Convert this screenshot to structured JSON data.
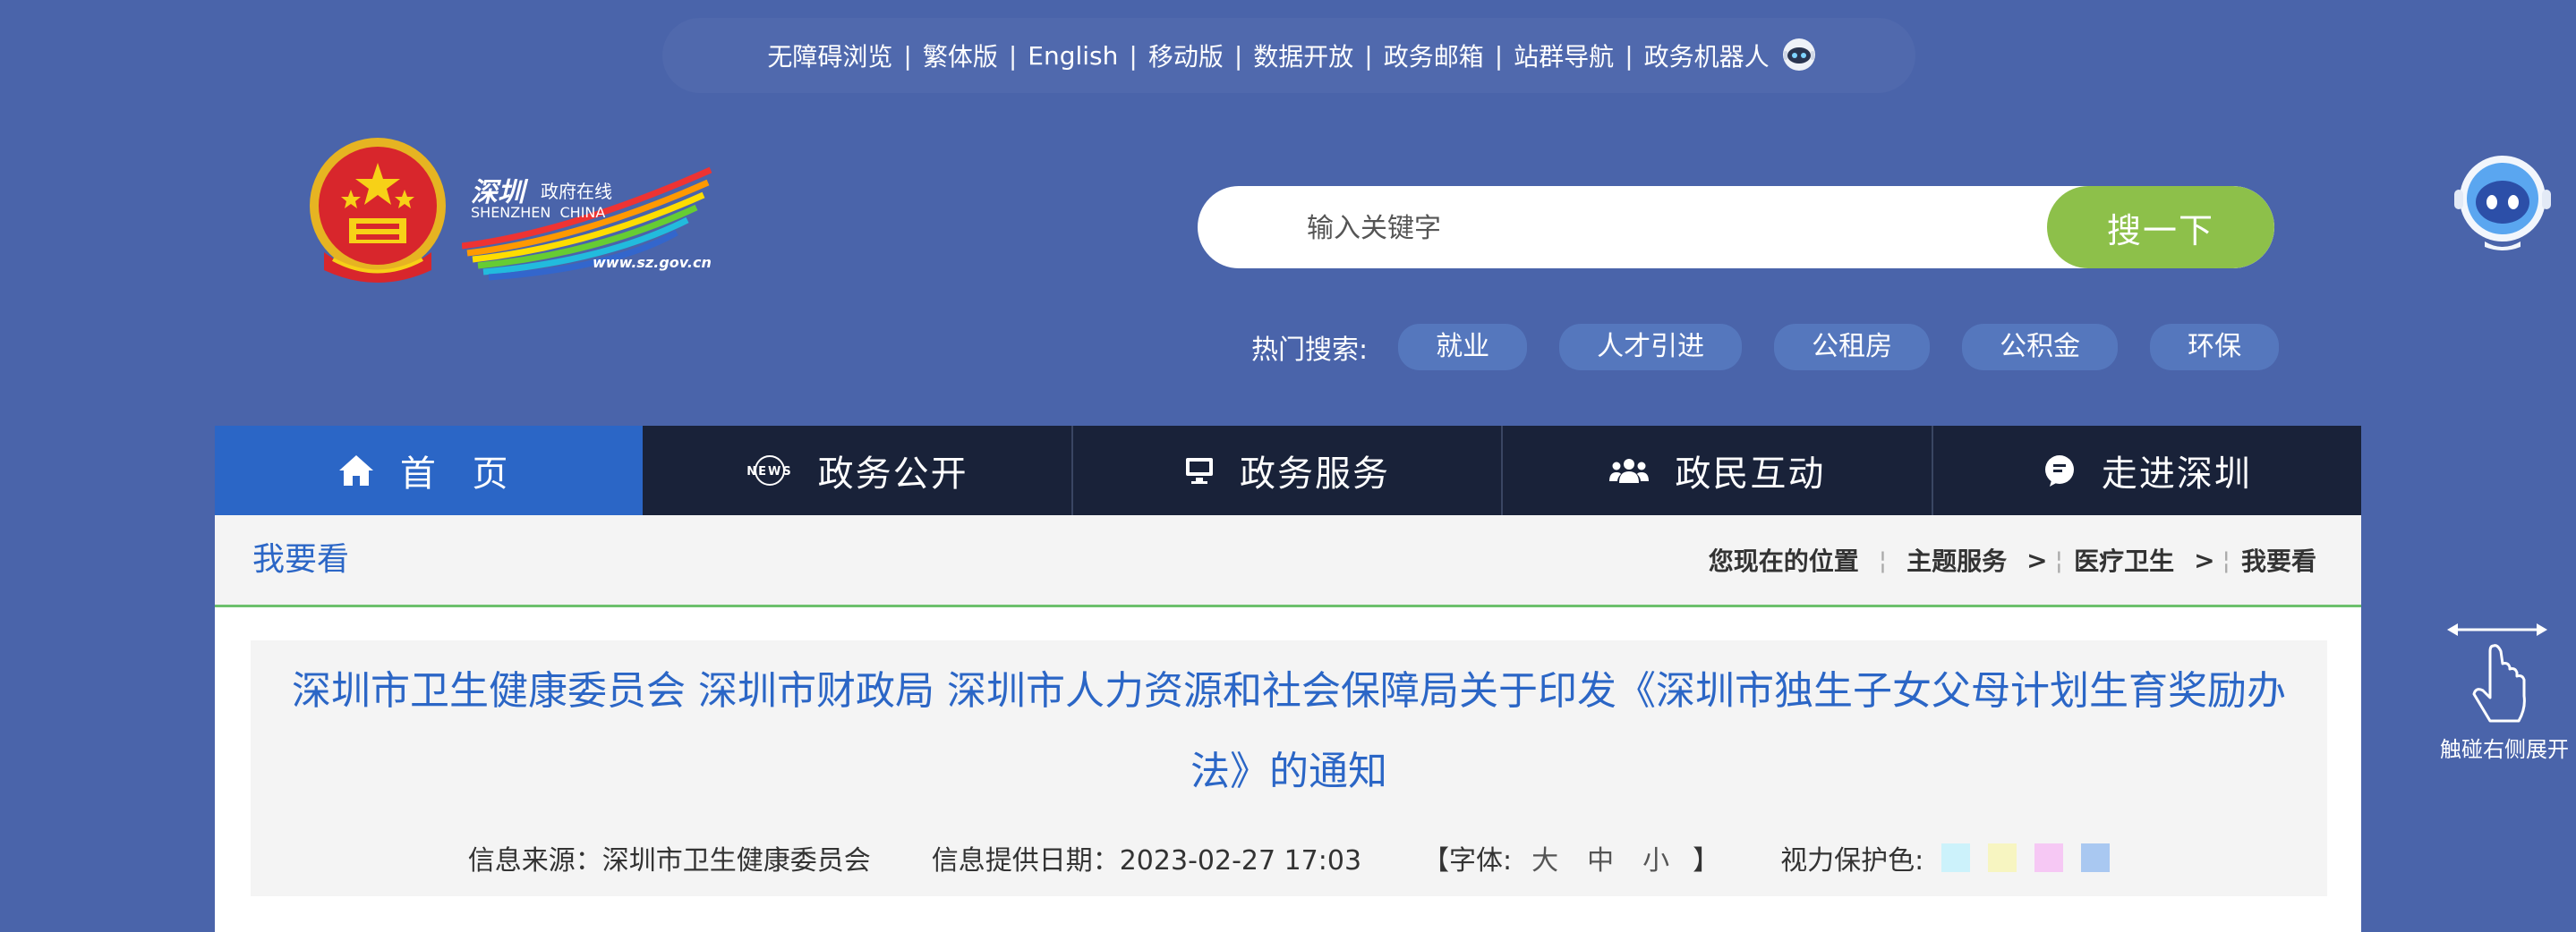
{
  "topbar": {
    "links": [
      "无障碍浏览",
      "繁体版",
      "English",
      "移动版",
      "数据开放",
      "政务邮箱",
      "站群导航",
      "政务机器人"
    ]
  },
  "logo": {
    "site_name_cn": "深圳",
    "site_name_sub": "政府在线",
    "site_name_en": "SHENZHEN  CHINA",
    "url": "www.sz.gov.cn"
  },
  "search": {
    "placeholder": "输入关键字",
    "button_label": "搜一下",
    "hot_label": "热门搜索:",
    "hot_tags": [
      "就业",
      "人才引进",
      "公租房",
      "公积金",
      "环保"
    ]
  },
  "nav": {
    "items": [
      "首 页",
      "政务公开",
      "政务服务",
      "政民互动",
      "走进深圳"
    ],
    "active_index": 0
  },
  "breadcrumb": {
    "title": "我要看",
    "location_label": "您现在的位置",
    "items": [
      "主题服务",
      "医疗卫生",
      "我要看"
    ]
  },
  "article": {
    "title": "深圳市卫生健康委员会 深圳市财政局 深圳市人力资源和社会保障局关于印发《深圳市独生子女父母计划生育奖励办法》的通知",
    "source": "信息来源：深圳市卫生健康委员会",
    "date": "信息提供日期：2023-02-27 17:03",
    "font_label_open": "【字体:",
    "font_sizes": [
      "大",
      "中",
      "小"
    ],
    "font_label_close": "】",
    "eye_label": "视力保护色:",
    "eye_colors": [
      "#ccf2fb",
      "#f7f5c1",
      "#f6c8f4",
      "#a9c8f1"
    ]
  },
  "side": {
    "swipe_label": "触碰右侧展开"
  },
  "colors": {
    "background": "#4a64aa",
    "nav_dark": "#192239",
    "nav_active": "#2b66c6",
    "search_button": "#8dc04a",
    "link_blue": "#2b66c6",
    "divider_green": "#6cc06c"
  }
}
